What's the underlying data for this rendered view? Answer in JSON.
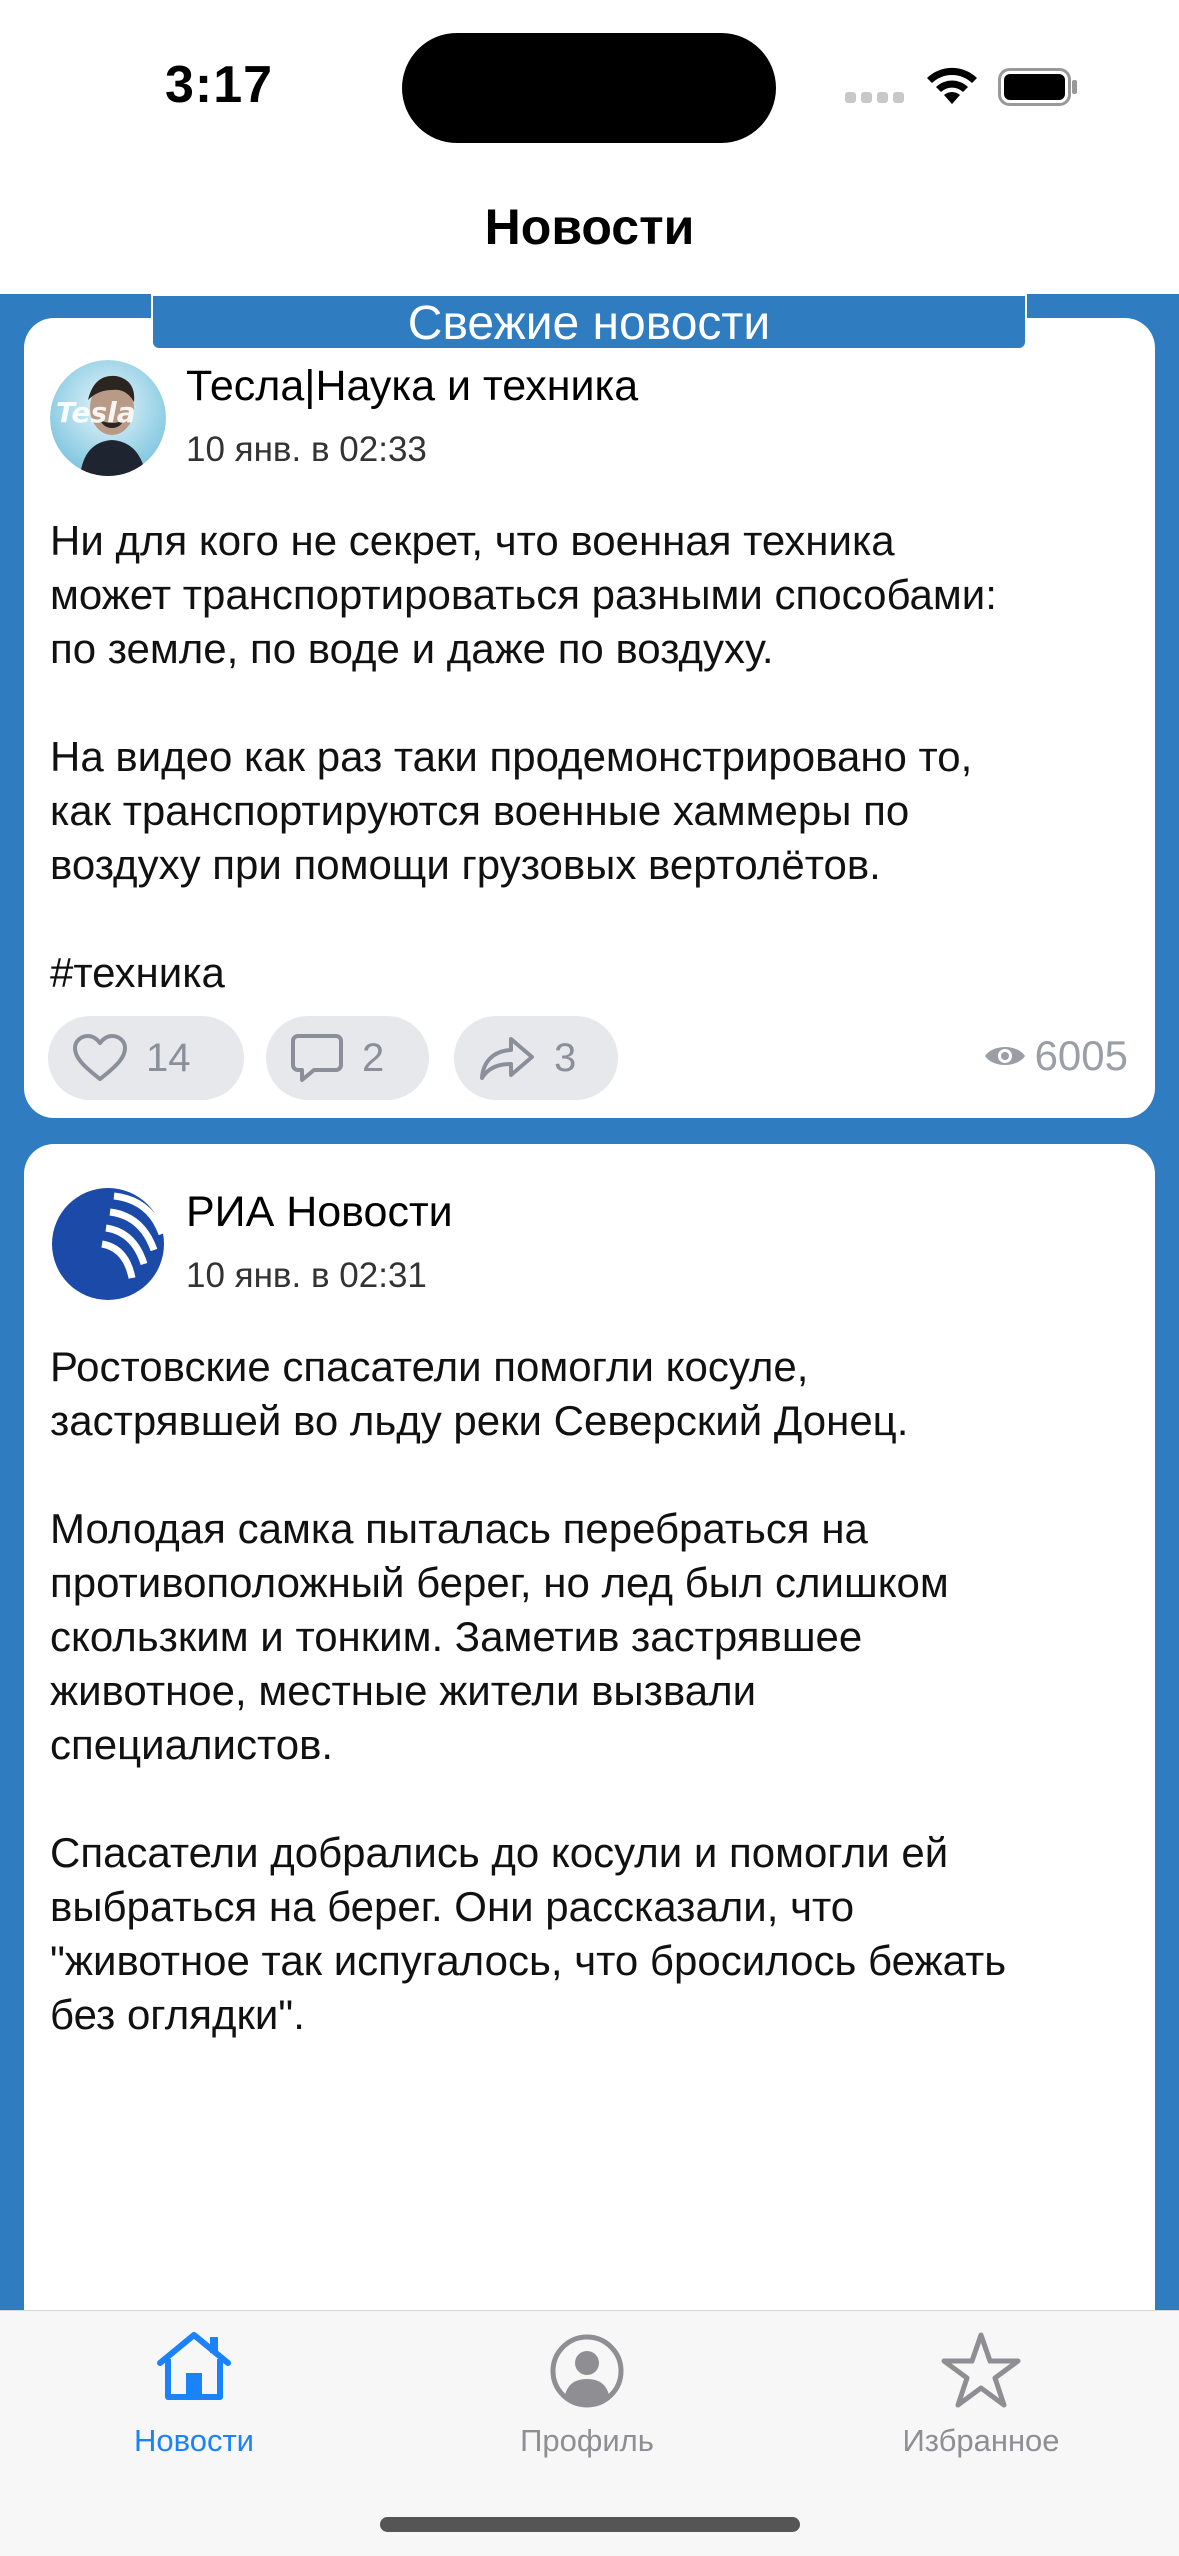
{
  "status_bar": {
    "time": "3:17"
  },
  "nav": {
    "title": "Новости"
  },
  "banner": {
    "label": "Свежие новости"
  },
  "posts": [
    {
      "source": "Тесла|Наука и техника",
      "date": "10 янв. в 02:33",
      "text": "Ни для кого не секрет, что военная техника\nможет транспортироваться разными способами:\nпо земле, по воде и даже по воздуху.\n\nНа видео как раз таки продемонстрировано то,\nкак транспортируются военные хаммеры по\nвоздуху при помощи грузовых вертолётов.\n\n#техника",
      "likes": "14",
      "comments": "2",
      "shares": "3",
      "views": "6005"
    },
    {
      "source": "РИА Новости",
      "date": "10 янв. в 02:31",
      "text": "Ростовские спасатели помогли косуле,\nзастрявшей во льду реки Северский Донец.\n\nМолодая самка пыталась перебраться на\nпротивоположный берег, но лед был слишком\nскользким и тонким. Заметив застрявшее\nживотное, местные жители вызвали\nспециалистов.\n\nСпасатели добрались до косули и помогли ей\nвыбраться на берег. Они рассказали, что\n\"животное так испугалось, что бросилось бежать\nбез оглядки\"."
    }
  ],
  "tabs": [
    {
      "label": "Новости",
      "icon": "house-icon",
      "active": true
    },
    {
      "label": "Профиль",
      "icon": "person-circle-icon",
      "active": false
    },
    {
      "label": "Избранное",
      "icon": "star-icon",
      "active": false
    }
  ],
  "colors": {
    "accent": "#1a82fb",
    "feed_background": "#2f7cc0",
    "inactive": "#8e8e93"
  }
}
